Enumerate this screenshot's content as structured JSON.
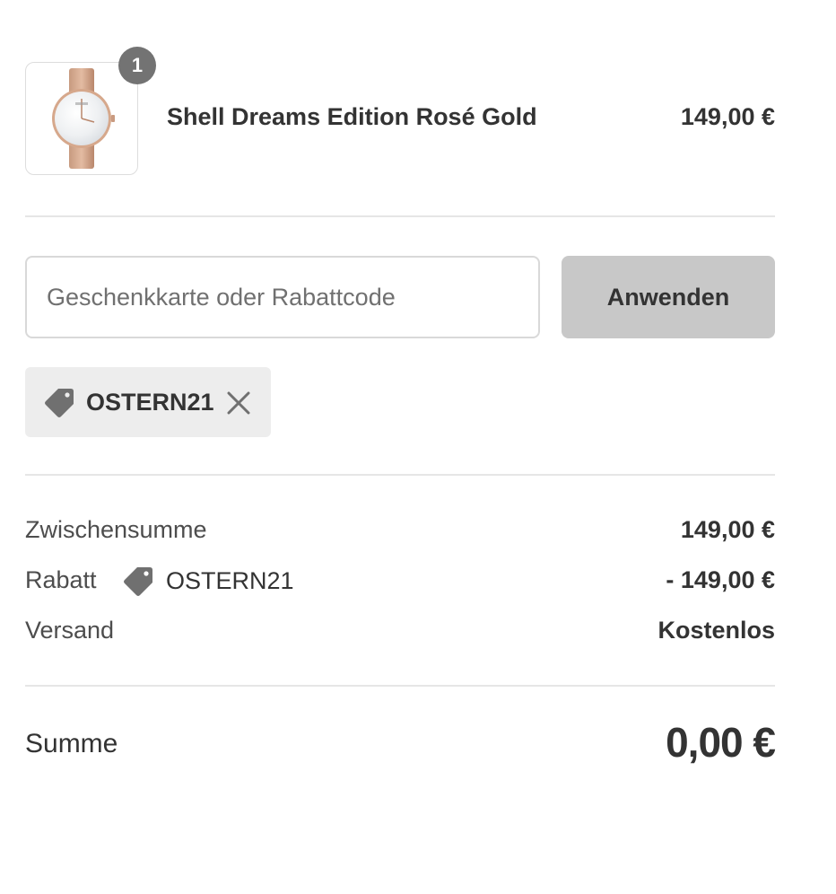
{
  "product": {
    "quantity": "1",
    "title": "Shell Dreams Edition Rosé Gold",
    "price": "149,00 €",
    "image_alt": "watch-image"
  },
  "discount_form": {
    "placeholder": "Geschenkkarte oder Rabattcode",
    "value": "",
    "apply_label": "Anwenden"
  },
  "applied_discount": {
    "code": "OSTERN21",
    "icon": "tag-icon",
    "remove_icon": "close-icon"
  },
  "totals": {
    "subtotal_label": "Zwischensumme",
    "subtotal_value": "149,00 €",
    "discount_label": "Rabatt",
    "discount_code": "OSTERN21",
    "discount_value": "- 149,00 €",
    "shipping_label": "Versand",
    "shipping_value": "Kostenlos",
    "total_label": "Summe",
    "total_value": "0,00 €"
  },
  "colors": {
    "badge": "#737373",
    "button": "#c8c8c8",
    "chip": "#ededed",
    "text": "#333333",
    "divider": "#e6e6e6"
  }
}
